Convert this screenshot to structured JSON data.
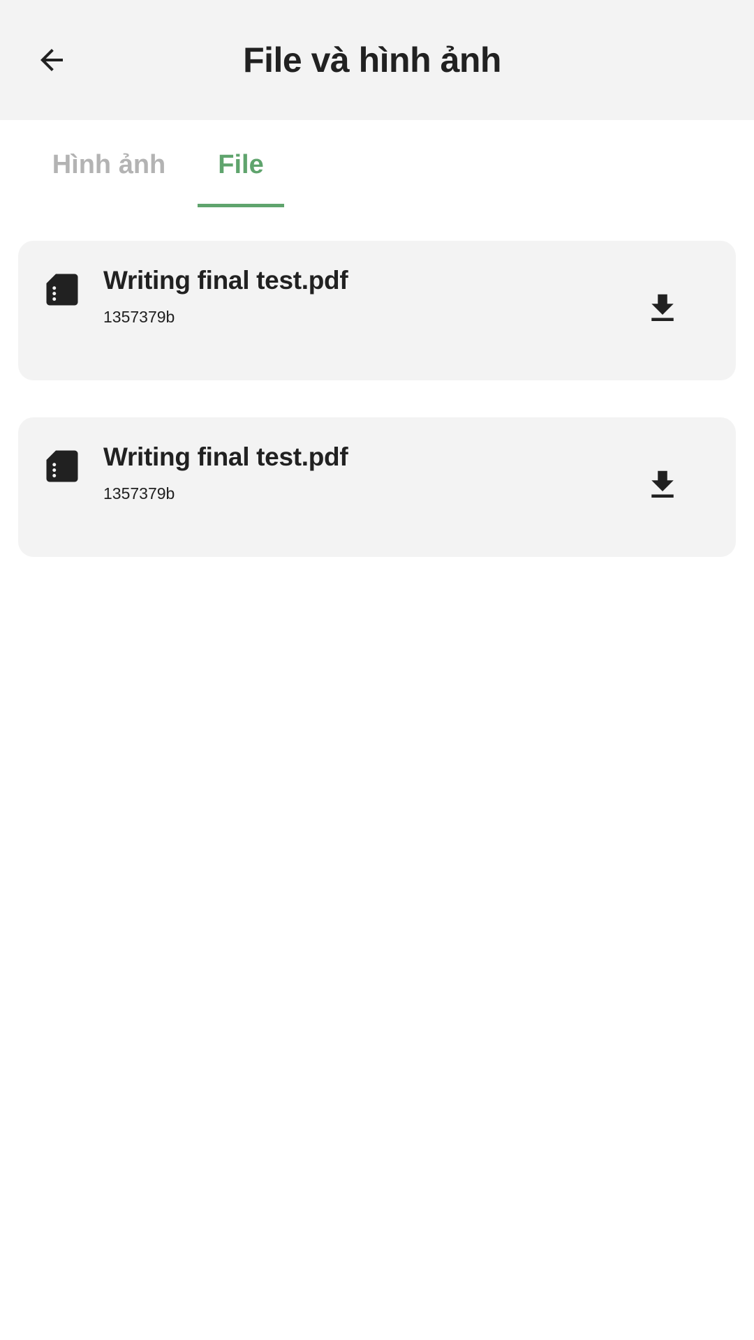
{
  "header": {
    "title": "File và hình ảnh",
    "back_icon": "arrow-back-icon"
  },
  "tabs": [
    {
      "label": "Hình ảnh",
      "active": false
    },
    {
      "label": "File",
      "active": true
    }
  ],
  "colors": {
    "accent": "#5fa46d",
    "inactive_tab": "#b3b3b3",
    "card_background": "#f3f3f3",
    "header_background": "#f3f3f3",
    "text": "#212121"
  },
  "files": [
    {
      "name": "Writing final test.pdf",
      "size": "1357379b",
      "icon": "file-icon",
      "action_icon": "download-icon"
    },
    {
      "name": "Writing final test.pdf",
      "size": "1357379b",
      "icon": "file-icon",
      "action_icon": "download-icon"
    }
  ]
}
